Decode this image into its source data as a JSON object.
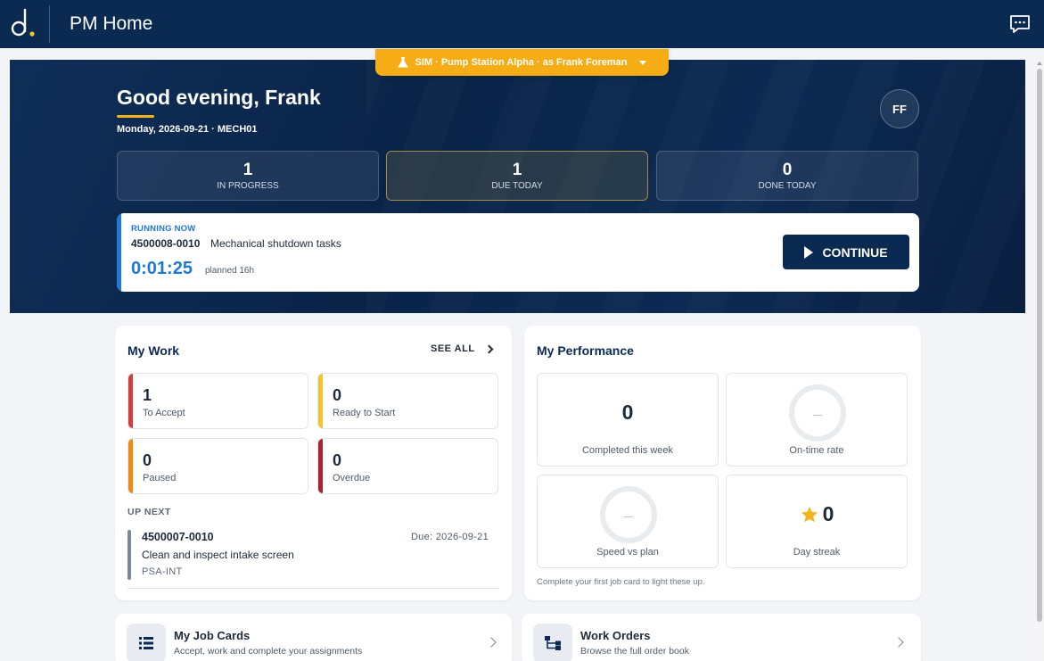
{
  "app": {
    "title": "PM Home"
  },
  "sim": {
    "label": "SIM · Pump Station Alpha · as Frank Foreman"
  },
  "hero": {
    "greeting": "Good evening, Frank",
    "date_line": "Monday, 2026-09-21 · MECH01",
    "avatar_initials": "FF",
    "stats": [
      {
        "value": "1",
        "label": "IN PROGRESS"
      },
      {
        "value": "1",
        "label": "DUE TODAY"
      },
      {
        "value": "0",
        "label": "DONE TODAY"
      }
    ],
    "running": {
      "label": "RUNNING NOW",
      "order_id": "4500008-0010",
      "description": "Mechanical shutdown tasks",
      "timer": "0:01:25",
      "planned": "planned 16h",
      "continue_label": "CONTINUE"
    }
  },
  "my_work": {
    "title": "My Work",
    "see_all": "SEE ALL",
    "tiles": [
      {
        "value": "1",
        "label": "To Accept",
        "color": "#d23c3c"
      },
      {
        "value": "0",
        "label": "Ready to Start",
        "color": "#f3c22e"
      },
      {
        "value": "0",
        "label": "Paused",
        "color": "#ef8a14"
      },
      {
        "value": "0",
        "label": "Overdue",
        "color": "#b01f2a"
      }
    ],
    "up_next": {
      "label": "UP NEXT",
      "order_id": "4500007-0010",
      "due": "Due: 2026-09-21",
      "description": "Clean and inspect intake screen",
      "location": "PSA-INT"
    }
  },
  "performance": {
    "title": "My Performance",
    "completed": {
      "value": "0",
      "label": "Completed this week"
    },
    "on_time": {
      "value": "—",
      "label": "On-time rate"
    },
    "speed": {
      "value": "—",
      "label": "Speed vs plan"
    },
    "streak": {
      "value": "0",
      "label": "Day streak"
    },
    "note": "Complete your first job card to light these up."
  },
  "links": [
    {
      "title": "My Job Cards",
      "subtitle": "Accept, work and complete your assignments",
      "icon": "list-icon"
    },
    {
      "title": "Work Orders",
      "subtitle": "Browse the full order book",
      "icon": "hierarchy-icon"
    }
  ],
  "colors": {
    "navy": "#0b2a52",
    "accent_blue": "#1e78d6",
    "amber": "#f6ac14",
    "star": "#f3b51b"
  }
}
